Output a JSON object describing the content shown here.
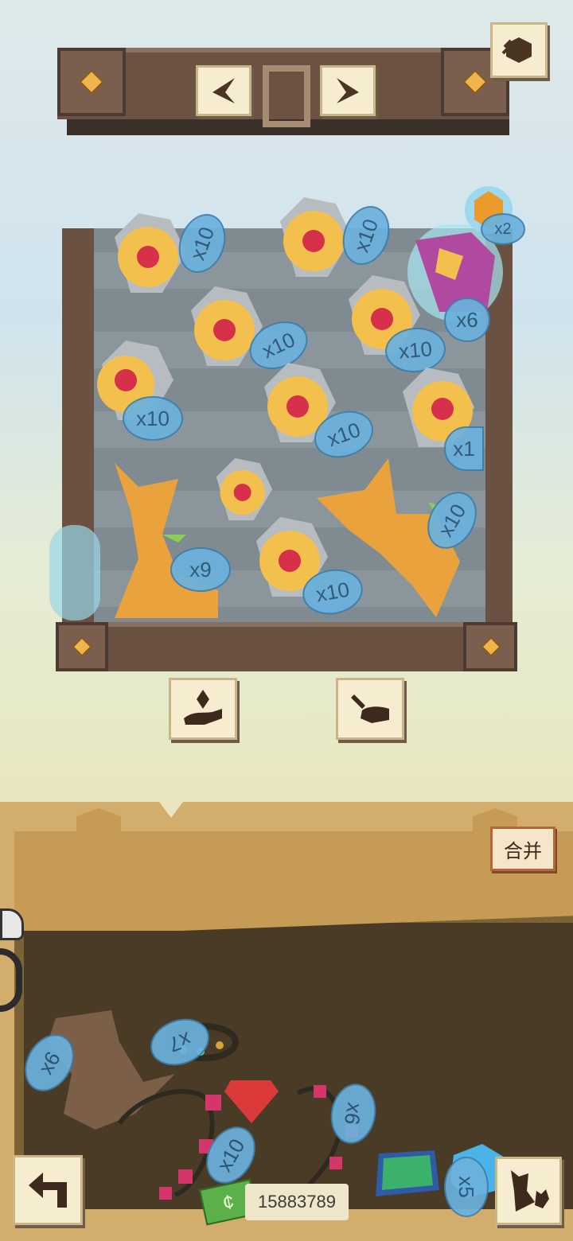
{
  "board_items": [
    {
      "name": "flower",
      "badge": "x10"
    },
    {
      "name": "flower",
      "badge": "x10"
    },
    {
      "name": "flower",
      "badge": "x10"
    },
    {
      "name": "flower",
      "badge": "x10"
    },
    {
      "name": "flower",
      "badge": "x10"
    },
    {
      "name": "flower",
      "badge": "x10"
    },
    {
      "name": "flower",
      "badge": "x10"
    },
    {
      "name": "flower",
      "badge": "x1"
    },
    {
      "name": "flower",
      "badge": "x10"
    },
    {
      "name": "cat",
      "badge": "x9"
    },
    {
      "name": "cat",
      "badge": "x10"
    },
    {
      "name": "rainbow-gem",
      "badge": "x6"
    },
    {
      "name": "amber-gem",
      "badge": "x2"
    }
  ],
  "inventory": {
    "merge_label": "合并",
    "coins": "15883789",
    "cash_symbol": "¢",
    "items": [
      {
        "name": "vase",
        "badge": "x6"
      },
      {
        "name": "bracelet",
        "badge": "x7"
      },
      {
        "name": "necklace",
        "badge": "x10"
      },
      {
        "name": "necklace",
        "badge": "x6"
      },
      {
        "name": "blue-gem",
        "badge": "x5"
      }
    ]
  },
  "colors": {
    "accent": "#6bb2dd",
    "wood": "#6a5142",
    "paper": "#f6ecd0",
    "box": "#c59b55"
  }
}
